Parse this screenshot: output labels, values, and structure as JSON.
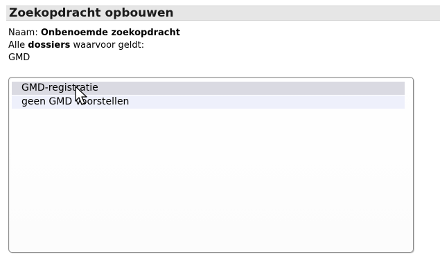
{
  "header": {
    "title": "Zoekopdracht opbouwen"
  },
  "query": {
    "name_label": "Naam:",
    "name_value": "Onbenoemde zoekopdracht",
    "scope_prefix": "Alle",
    "scope_entity": "dossiers",
    "scope_suffix": "waarvoor geldt:",
    "group": "GMD"
  },
  "list": {
    "items": [
      {
        "label": "GMD-registratie",
        "state": "hover"
      },
      {
        "label": "geen GMD voorstellen",
        "state": "normal"
      }
    ]
  },
  "cursor": {
    "icon": "arrow-pointer-icon"
  }
}
